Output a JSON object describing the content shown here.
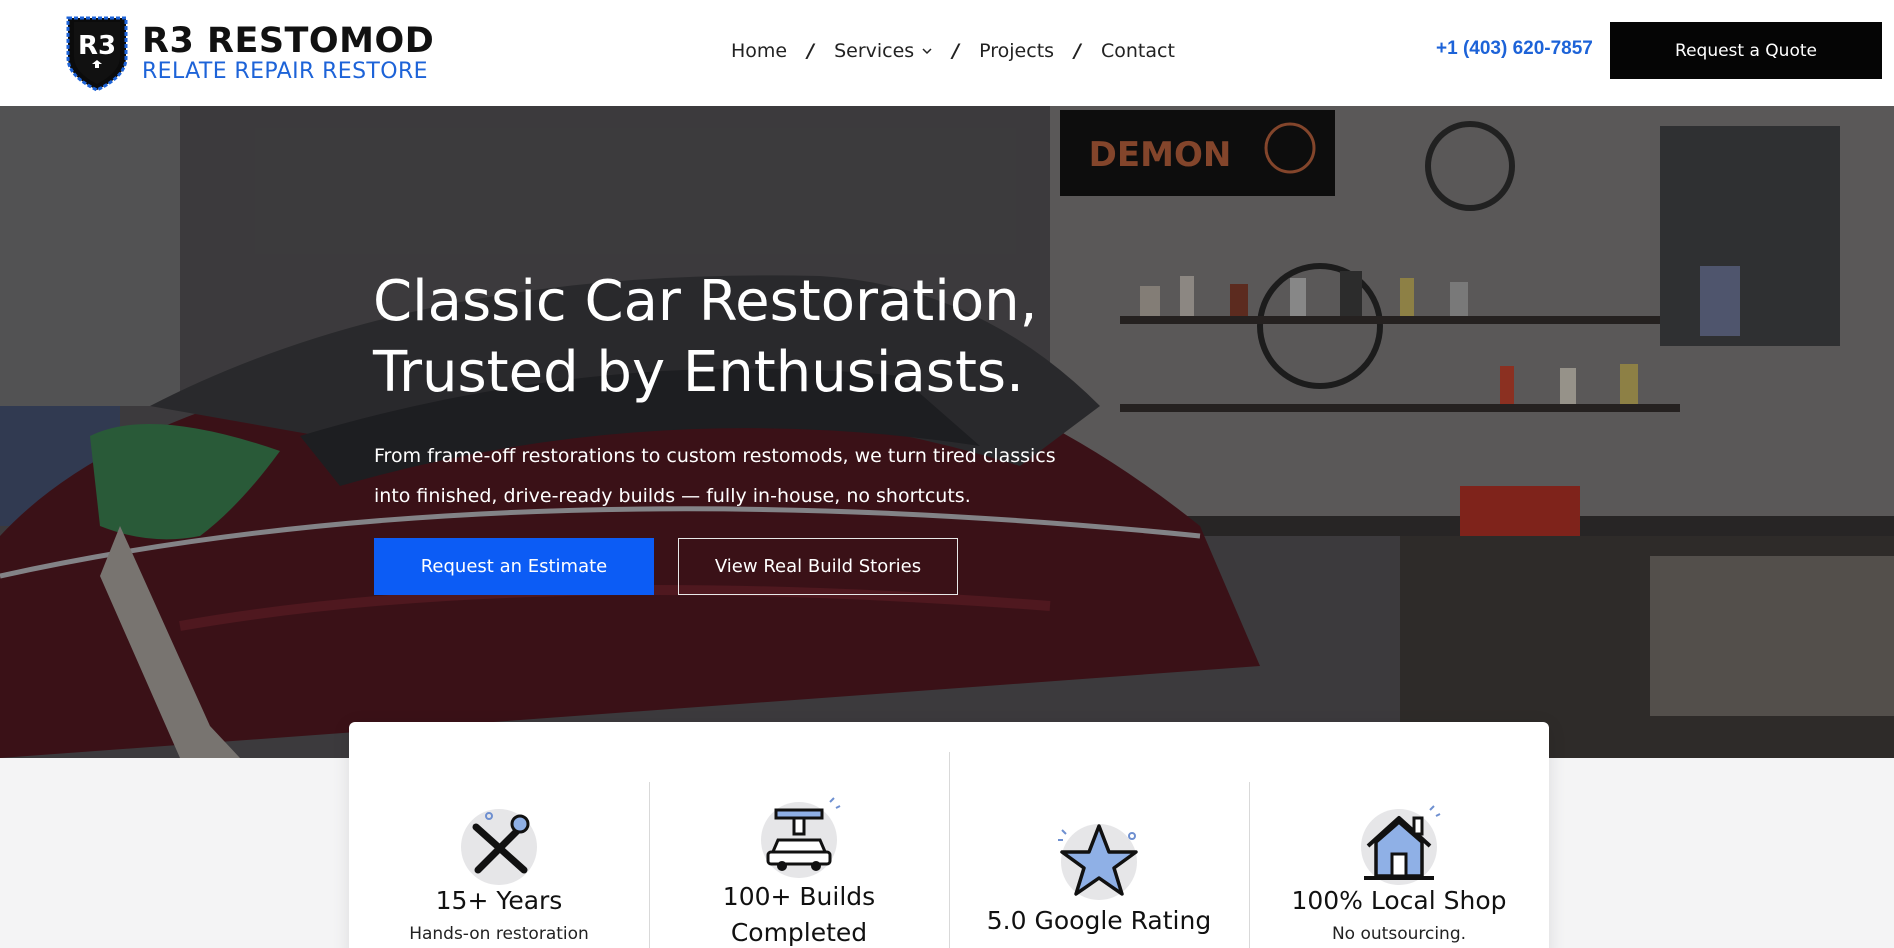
{
  "brand": {
    "name": "R3 RESTOMOD",
    "tagline": "RELATE REPAIR RESTORE",
    "badge_letters": "R3",
    "colors": {
      "accent": "#1d63d8",
      "primary_button": "#0c5cf5",
      "dark_button": "#050505"
    }
  },
  "nav": {
    "items": [
      {
        "label": "Home"
      },
      {
        "label": "Services",
        "has_dropdown": true
      },
      {
        "label": "Projects"
      },
      {
        "label": "Contact"
      }
    ],
    "separator": "/"
  },
  "header": {
    "phone": "+1 (403) 620-7857",
    "cta_label": "Request a Quote"
  },
  "hero": {
    "title_line1": "Classic Car Restoration,",
    "title_line2": "Trusted by Enthusiasts.",
    "subtitle_line1": "From frame-off restorations to custom restomods, we turn tired classics",
    "subtitle_line2": "into finished, drive-ready builds — fully in-house, no shortcuts.",
    "primary_cta": "Request an Estimate",
    "secondary_cta": "View Real Build Stories",
    "banner_text": "DEMON"
  },
  "stats": [
    {
      "icon": "tools-icon",
      "title": "15+ Years",
      "desc": "Hands-on restoration"
    },
    {
      "icon": "car-lift-icon",
      "title": "100+ Builds",
      "title2": "Completed",
      "desc": ""
    },
    {
      "icon": "star-icon",
      "title": "5.0 Google Rating",
      "desc": ""
    },
    {
      "icon": "house-icon",
      "title": "100% Local Shop",
      "desc": "No outsourcing."
    }
  ]
}
